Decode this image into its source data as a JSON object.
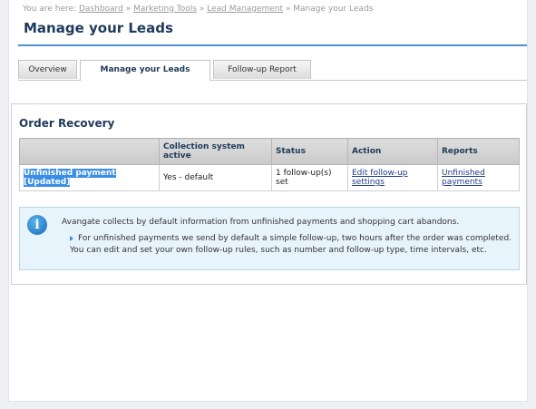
{
  "breadcrumb": {
    "prefix": "You are here:",
    "items": [
      {
        "label": "Dashboard"
      },
      {
        "label": "Marketing Tools"
      },
      {
        "label": "Lead Management"
      }
    ],
    "current": "Manage your Leads",
    "separator": "»"
  },
  "page": {
    "title": "Manage your Leads"
  },
  "tabs": [
    {
      "label": "Overview",
      "active": false
    },
    {
      "label": "Manage your Leads",
      "active": true
    },
    {
      "label": "Follow-up Report",
      "active": false
    }
  ],
  "section": {
    "title": "Order Recovery"
  },
  "table": {
    "headers": [
      "",
      "Collection system active",
      "Status",
      "Action",
      "Reports"
    ],
    "rows": [
      {
        "name": "Unfinished payment",
        "tag": "[Updated]",
        "collection": "Yes - default",
        "status": "1 follow-up(s) set",
        "action": "Edit follow-up settings",
        "report": "Unfinished payments"
      }
    ]
  },
  "info": {
    "icon": "info-icon",
    "lead": "Avangate collects by default information from unfinished payments and shopping cart abandons.",
    "bullet_line1": "For unfinished payments we send by default a simple follow-up, two hours after the order was completed.",
    "bullet_line2": "You can edit and set your own follow-up rules, such as number and follow-up type, time intervals, etc."
  },
  "colors": {
    "title": "#1f3a5a",
    "accent_rule": "#4f91cc",
    "selection": "#3a8ee6",
    "info_bg": "#e8f4fc"
  }
}
